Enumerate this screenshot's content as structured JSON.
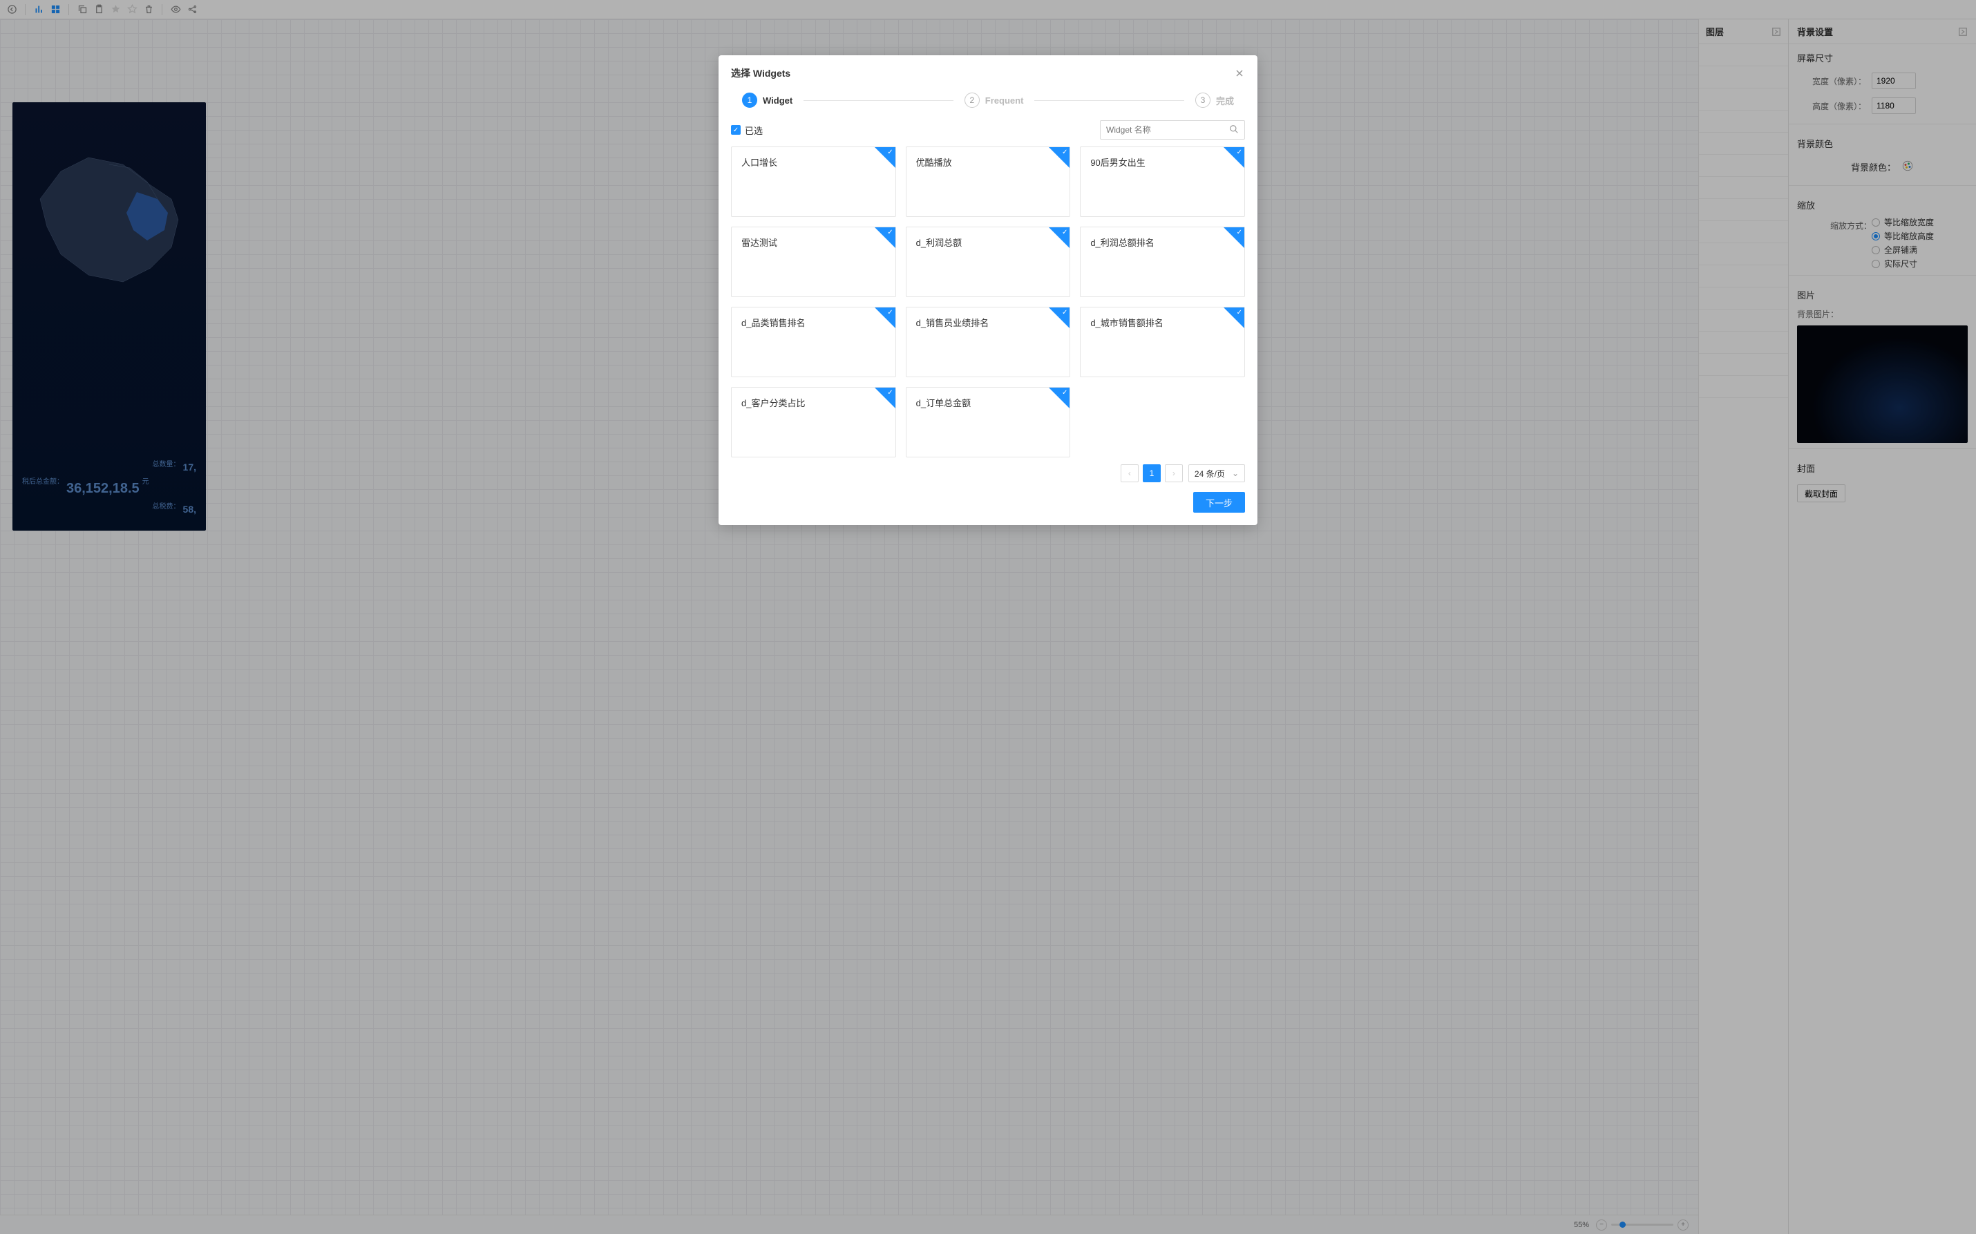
{
  "toolbar": {
    "icons": [
      "back-icon",
      "chart-icon",
      "grid-icon",
      "copy-icon",
      "paste-icon",
      "star-icon",
      "star-outline-icon",
      "trash-icon",
      "eye-icon",
      "share-icon"
    ]
  },
  "canvas": {
    "map": {
      "row1_label": "总数量：",
      "row1_value": "17,",
      "row2_label": "税后总金额：",
      "row2_value": "36,152,18.5",
      "row2_unit": "元",
      "row3_label": "总税费：",
      "row3_value": "58,"
    },
    "zoom_pct": "55%"
  },
  "layers": {
    "title": "图层"
  },
  "settings": {
    "title": "背景设置",
    "screen_size_title": "屏幕尺寸",
    "width_label": "宽度（像素）：",
    "width_value": "1920",
    "height_label": "高度（像素）：",
    "height_value": "1180",
    "bg_color_title": "背景颜色",
    "bg_color_label": "背景颜色：",
    "scale_title": "缩放",
    "scale_label": "缩放方式：",
    "scale_options": [
      "等比缩放宽度",
      "等比缩放高度",
      "全屏铺满",
      "实际尺寸"
    ],
    "scale_selected_index": 1,
    "image_title": "图片",
    "bg_image_label": "背景图片：",
    "cover_title": "封面",
    "capture_cover_btn": "截取封面"
  },
  "modal": {
    "title": "选择 Widgets",
    "steps": [
      {
        "num": "1",
        "label": "Widget"
      },
      {
        "num": "2",
        "label": "Frequent"
      },
      {
        "num": "3",
        "label": "完成"
      }
    ],
    "selected_label": "已选",
    "search_placeholder": "Widget 名称",
    "widgets": [
      "人口增长",
      "优酷播放",
      "90后男女出生",
      "雷达测试",
      "d_利润总额",
      "d_利润总额排名",
      "d_品类销售排名",
      "d_销售员业绩排名",
      "d_城市销售额排名",
      "d_客户分类占比",
      "d_订单总金额"
    ],
    "page_current": "1",
    "page_size_label": "24 条/页",
    "next_btn": "下一步"
  }
}
